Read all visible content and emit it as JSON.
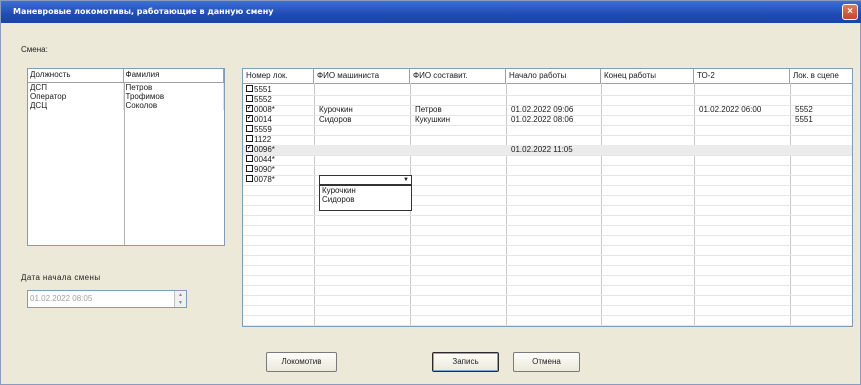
{
  "window": {
    "title": "Маневровые локомотивы, работающие в данную смену",
    "close_glyph": "×"
  },
  "shift_label": "Смена:",
  "left_table": {
    "headers": [
      "Должность",
      "Фамилия"
    ],
    "rows": [
      [
        "ДСП",
        "Петров"
      ],
      [
        "Оператор",
        "Трофимов"
      ],
      [
        "ДСЦ",
        "Соколов"
      ]
    ]
  },
  "date_label": "Дата  начала  смены",
  "date_value": "01.02.2022 08:05",
  "main_table": {
    "headers": [
      "Номер лок.",
      "ФИО машиниста",
      "ФИО составит.",
      "Начало работы",
      "Конец работы",
      "ТО-2",
      "Лок. в сцепе"
    ],
    "rows": [
      {
        "checked": false,
        "loco": "5551",
        "driver": "",
        "compiler": "",
        "start": "",
        "end": "",
        "to2": "",
        "coupled": ""
      },
      {
        "checked": false,
        "loco": "5552",
        "driver": "",
        "compiler": "",
        "start": "",
        "end": "",
        "to2": "",
        "coupled": ""
      },
      {
        "checked": true,
        "loco": "0008*",
        "driver": "Курочкин",
        "compiler": "Петров",
        "start": "01.02.2022 09:06",
        "end": "",
        "to2": "01.02.2022 06:00",
        "coupled": "5552"
      },
      {
        "checked": true,
        "loco": "0014",
        "driver": "Сидоров",
        "compiler": "Кукушкин",
        "start": "01.02.2022 08:06",
        "end": "",
        "to2": "",
        "coupled": "5551"
      },
      {
        "checked": false,
        "loco": "5559",
        "driver": "",
        "compiler": "",
        "start": "",
        "end": "",
        "to2": "",
        "coupled": ""
      },
      {
        "checked": false,
        "loco": "1122",
        "driver": "",
        "compiler": "",
        "start": "",
        "end": "",
        "to2": "",
        "coupled": ""
      },
      {
        "checked": true,
        "loco": "0096*",
        "driver": "",
        "compiler": "",
        "start": "01.02.2022 11:05",
        "end": "",
        "to2": "",
        "coupled": ""
      },
      {
        "checked": false,
        "loco": "0044*",
        "driver": "",
        "compiler": "",
        "start": "",
        "end": "",
        "to2": "",
        "coupled": ""
      },
      {
        "checked": false,
        "loco": "9090*",
        "driver": "",
        "compiler": "",
        "start": "",
        "end": "",
        "to2": "",
        "coupled": ""
      },
      {
        "checked": false,
        "loco": "0078*",
        "driver": "",
        "compiler": "",
        "start": "",
        "end": "",
        "to2": "",
        "coupled": ""
      }
    ],
    "dropdown_value": "",
    "dropdown_options": [
      "Курочкин",
      "Сидоров"
    ]
  },
  "buttons": {
    "locomotive": "Локомотив",
    "save": "Запись",
    "cancel": "Отмена"
  }
}
